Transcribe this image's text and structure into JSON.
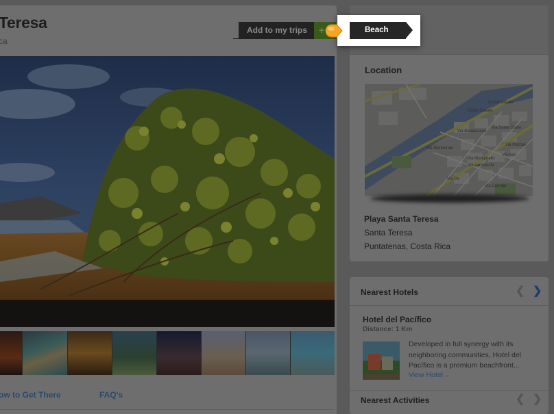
{
  "header": {
    "title": "Teresa",
    "subtitle": "ca",
    "add_trips_label": "Add to my trips",
    "add_symbol": "+"
  },
  "tooltip": {
    "tag_label": "Beach",
    "accent_color": "#f5a623"
  },
  "thumbnails": [
    {
      "name": "sunset-rocks"
    },
    {
      "name": "beach-aerial"
    },
    {
      "name": "golden-sunset"
    },
    {
      "name": "palm-trees"
    },
    {
      "name": "dusk-clouds"
    },
    {
      "name": "sandy-shore"
    },
    {
      "name": "cloudy-beach"
    },
    {
      "name": "blue-coast"
    }
  ],
  "bottom_links": {
    "how_to_get_there": "ow to Get There",
    "faqs": "FAQ's"
  },
  "location": {
    "heading": "Location",
    "place_name": "Playa Santa Teresa",
    "line1": "Santa Teresa",
    "line2": "Puntatenas, Costa Rica",
    "map_labels": [
      "Corso Casale",
      "Corso Casale",
      "Via Monferrato",
      "Via Bardassano",
      "Via Santa Giulia",
      "Via Mazzini",
      "Via Lanfranchi",
      "Via Montebello",
      "Via Po",
      "Via Asti",
      "Via Cernaia"
    ]
  },
  "hotels": {
    "heading": "Nearest Hotels",
    "prev_symbol": "❮",
    "next_symbol": "❯",
    "name": "Hotel del Pacífico",
    "distance": "Distance: 1 Km",
    "description": "Developed in full synergy with its neighboring communities, Hotel del Pacífico is a premium beachfront...",
    "view_link": "View Hotel→"
  },
  "activities": {
    "heading": "Nearest Activities",
    "prev_symbol": "❮",
    "next_symbol": "❯"
  }
}
